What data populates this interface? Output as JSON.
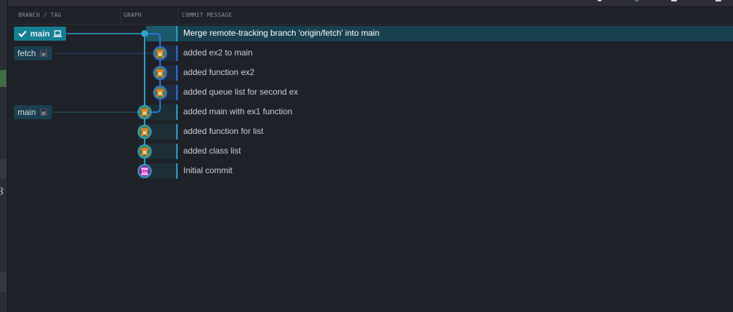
{
  "columns": {
    "branch_tag": "BRANCH / TAG",
    "graph": "GRAPH",
    "commit_message": "COMMIT MESSAGE"
  },
  "branches": {
    "main_local": "main",
    "fetch_remote": "fetch",
    "main_remote": "main"
  },
  "commits": [
    {
      "message": "Merge remote-tracking branch 'origin/fetch' into main",
      "selected": true,
      "avatar": "merge-dot"
    },
    {
      "message": "added ex2 to main",
      "avatar": "orange-avatar"
    },
    {
      "message": "added function ex2",
      "avatar": "orange-avatar"
    },
    {
      "message": "added queue list for second ex",
      "avatar": "orange-avatar"
    },
    {
      "message": "added main with ex1 function",
      "avatar": "orange-avatar"
    },
    {
      "message": "added function for list",
      "avatar": "orange-avatar"
    },
    {
      "message": "added class list",
      "avatar": "orange-avatar"
    },
    {
      "message": "Initial commit",
      "avatar": "purple-avatar"
    }
  ],
  "colors": {
    "background": "#1f2128",
    "selected_row": "#19404f",
    "branch_local": "#157f93",
    "branch_remote": "#1b3f50",
    "graph_main": "#2ea1c9",
    "graph_fetch": "#2f73d9"
  },
  "icons": {
    "check": "check-icon",
    "computer": "laptop-icon",
    "remote": "remote-avatar-icon"
  }
}
